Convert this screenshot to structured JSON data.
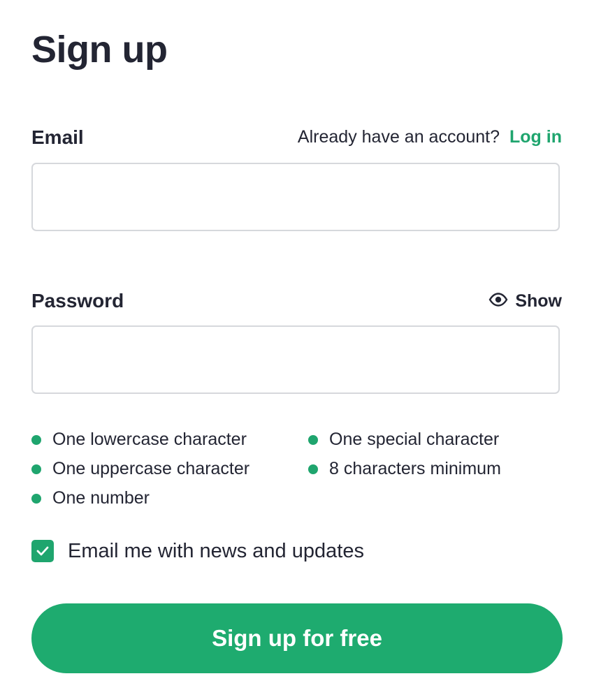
{
  "page": {
    "title": "Sign up"
  },
  "email": {
    "label": "Email",
    "value": "",
    "placeholder": "",
    "already_text": "Already have an account?",
    "login_link": "Log in"
  },
  "password": {
    "label": "Password",
    "value": "",
    "placeholder": "",
    "show_label": "Show",
    "show_icon": "eye-icon"
  },
  "rules": {
    "left": [
      "One lowercase character",
      "One uppercase character",
      "One number"
    ],
    "right": [
      "One special character",
      "8 characters minimum"
    ]
  },
  "newsletter": {
    "label": "Email me with news and updates",
    "checked": true
  },
  "submit": {
    "label": "Sign up for free"
  },
  "colors": {
    "accent": "#1fa56e",
    "text": "#232533",
    "border": "#d6d8dc"
  }
}
